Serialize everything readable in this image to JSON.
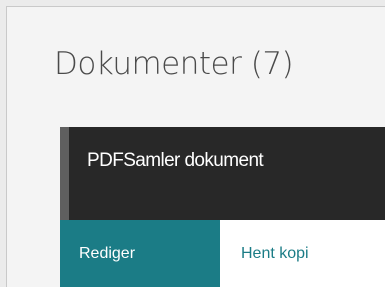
{
  "page": {
    "title": "Dokumenter (7)"
  },
  "document": {
    "name": "PDFSamler dokument",
    "actions": {
      "edit_label": "Rediger",
      "copy_label": "Hent kopi"
    }
  },
  "colors": {
    "accent": "#1b7c86",
    "header_bg": "#282828",
    "page_bg": "#f4f4f4"
  }
}
